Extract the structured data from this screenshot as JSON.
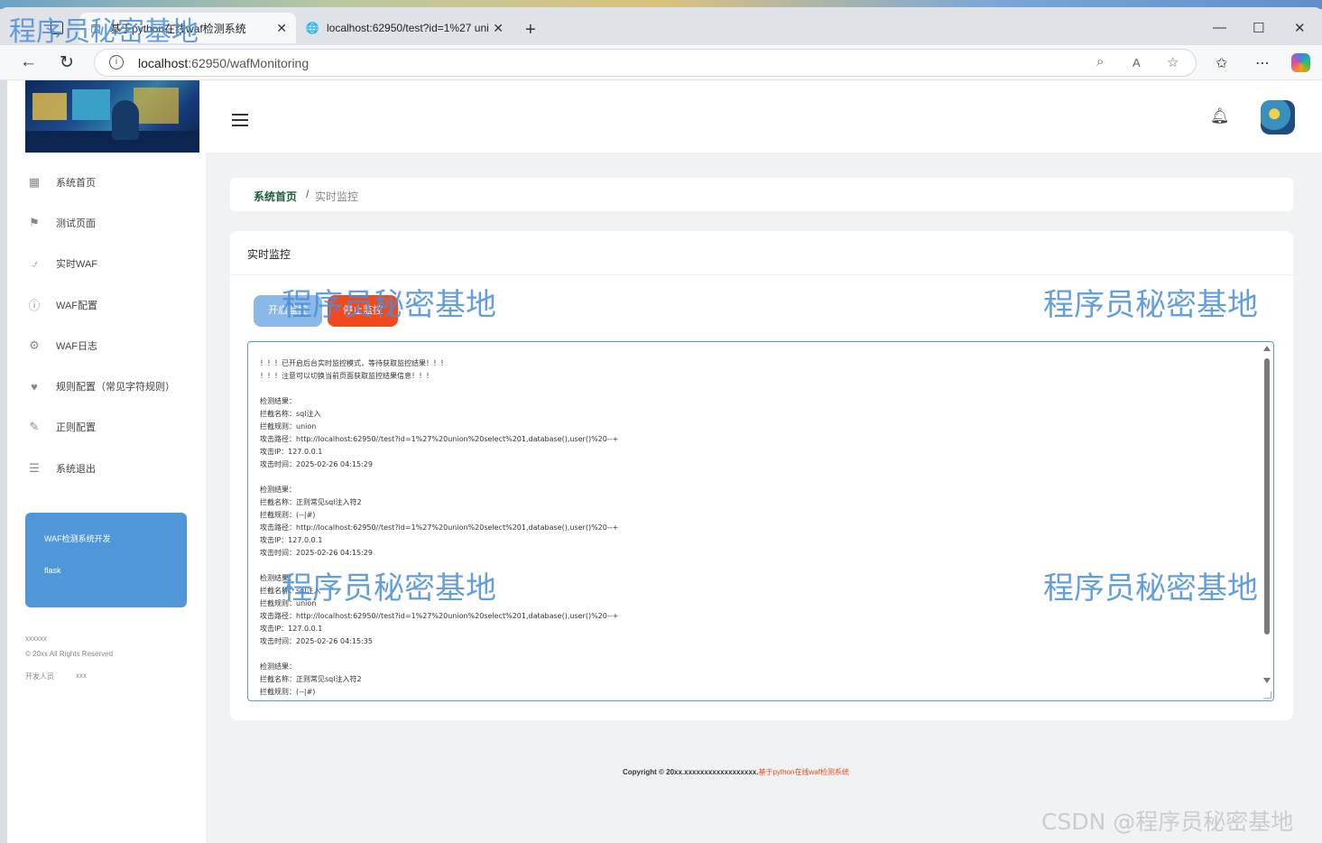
{
  "browser": {
    "tabs": [
      {
        "title": "基于python在线waf检测系统",
        "active": true
      },
      {
        "title": "localhost:62950/test?id=1%27 uni",
        "active": false
      }
    ],
    "url_host": "localhost",
    "url_rest": ":62950/wafMonitoring",
    "icons": {
      "back": "←",
      "reload": "↻",
      "new_tab": "+",
      "minimize": "—",
      "maximize": "☐",
      "close": "✕"
    }
  },
  "sidebar": {
    "items": [
      {
        "label": "系统首页",
        "icon": "dashboard-icon"
      },
      {
        "label": "测试页面",
        "icon": "flag-icon"
      },
      {
        "label": "实时WAF",
        "icon": "pulse-icon"
      },
      {
        "label": "WAF配置",
        "icon": "info-icon"
      },
      {
        "label": "WAF日志",
        "icon": "gear-icon"
      },
      {
        "label": "规则配置（常见字符规则）",
        "icon": "heart-icon"
      },
      {
        "label": "正则配置",
        "icon": "edit-icon"
      },
      {
        "label": "系统退出",
        "icon": "list-icon"
      }
    ],
    "promo": {
      "line1": "WAF检测系统开发",
      "line2": "flask"
    },
    "footer": {
      "line1": "xxxxxx",
      "line2": "© 20xx All Rights Reserved",
      "dev_label": "开发人员",
      "dev_name": "xxx"
    }
  },
  "breadcrumb": {
    "home": "系统首页",
    "separator": "/",
    "current": "实时监控"
  },
  "card": {
    "title": "实时监控",
    "start_button": "开启监控",
    "stop_button": "停止监控"
  },
  "log_text": "！！！已开启后台实时监控模式，等待获取监控结果！！！\n！！！注意可以切换当前页面获取监控结果信息！！！\n\n检测结果：\n拦截名称：sql注入\n拦截规则：union\n攻击路径：http://localhost:62950//test?id=1%27%20union%20select%201,database(),user()%20--+\n攻击IP：127.0.0.1\n攻击时间：2025-02-26 04:15:29\n\n检测结果：\n拦截名称：正则常见sql注入符2\n拦截规则：(--|#)\n攻击路径：http://localhost:62950//test?id=1%27%20union%20select%201,database(),user()%20--+\n攻击IP：127.0.0.1\n攻击时间：2025-02-26 04:15:29\n\n检测结果：\n拦截名称：sql注入\n拦截规则：union\n攻击路径：http://localhost:62950//test?id=1%27%20union%20select%201,database(),user()%20--+\n攻击IP：127.0.0.1\n攻击时间：2025-02-26 04:15:35\n\n检测结果：\n拦截名称：正则常见sql注入符2\n拦截规则：(--|#)",
  "footer": {
    "copyright": "Copyright © 20xx.xxxxxxxxxxxxxxxxxx.",
    "project": "基于python在线waf检测系统"
  },
  "watermark": "程序员秘密基地",
  "csdn_watermark": "CSDN @程序员秘密基地",
  "colors": {
    "accent_blue": "#4f97d8",
    "stop_red": "#f2491e",
    "start_blue": "#8ab8e8",
    "breadcrumb_green": "#1b5e3b"
  }
}
